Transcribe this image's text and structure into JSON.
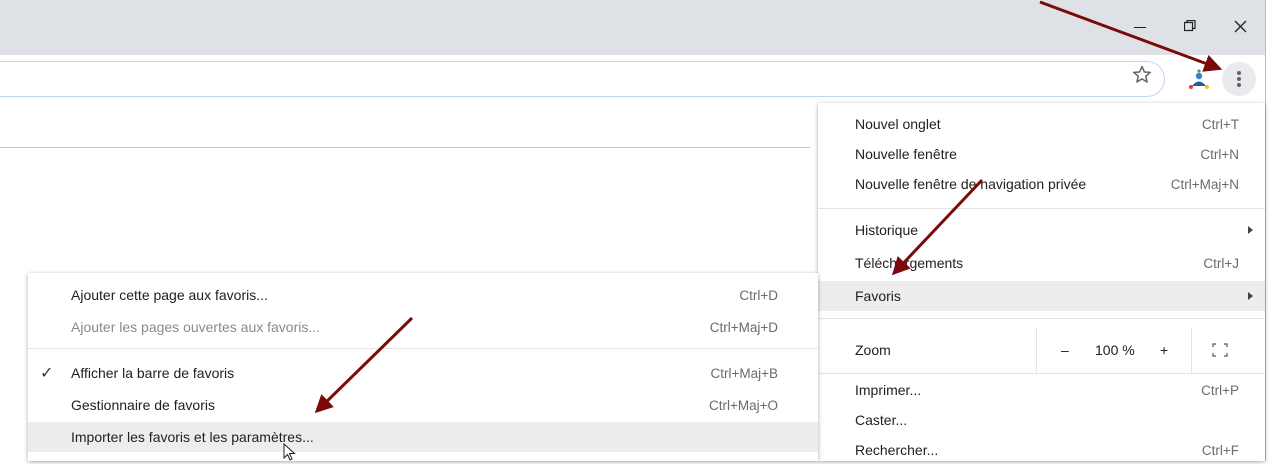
{
  "window": {
    "minimize_label": "–",
    "restore_label": "restore",
    "close_label": "✕"
  },
  "toolbar": {
    "bookmark_star_icon": "star-outline-icon",
    "extension_icon": "extension-icon",
    "menu_icon": "three-dots-vertical-icon"
  },
  "main_menu": {
    "items": [
      {
        "label": "Nouvel onglet",
        "shortcut": "Ctrl+T"
      },
      {
        "label": "Nouvelle fenêtre",
        "shortcut": "Ctrl+N"
      },
      {
        "label": "Nouvelle fenêtre de navigation privée",
        "shortcut": "Ctrl+Maj+N"
      },
      {
        "label": "Historique",
        "shortcut": ""
      },
      {
        "label": "Téléchargements",
        "shortcut": "Ctrl+J"
      },
      {
        "label": "Favoris",
        "shortcut": ""
      }
    ],
    "zoom": {
      "label": "Zoom",
      "minus": "–",
      "value": "100 %",
      "plus": "+"
    },
    "items2": [
      {
        "label": "Imprimer...",
        "shortcut": "Ctrl+P"
      },
      {
        "label": "Caster...",
        "shortcut": ""
      },
      {
        "label": "Rechercher...",
        "shortcut": "Ctrl+F"
      }
    ]
  },
  "bookmarks_submenu": {
    "items": [
      {
        "label": "Ajouter cette page aux favoris...",
        "shortcut": "Ctrl+D"
      },
      {
        "label": "Ajouter les pages ouvertes aux favoris...",
        "shortcut": "Ctrl+Maj+D"
      },
      {
        "label": "Afficher la barre de favoris",
        "shortcut": "Ctrl+Maj+B",
        "check": "✓"
      },
      {
        "label": "Gestionnaire de favoris",
        "shortcut": "Ctrl+Maj+O"
      },
      {
        "label": "Importer les favoris et les paramètres...",
        "shortcut": ""
      }
    ]
  },
  "colors": {
    "annotation_arrow": "#7b0a0a",
    "titlebar": "#dee1e6",
    "highlight": "#ededed"
  }
}
